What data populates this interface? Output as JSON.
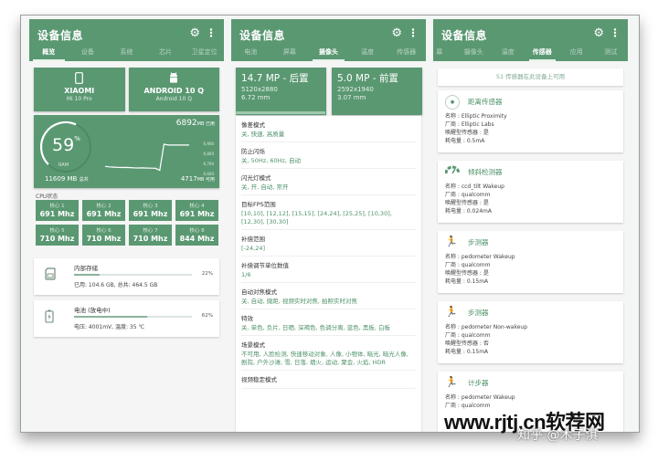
{
  "app_title": "设备信息",
  "icons": {
    "settings": "gear-icon",
    "more": "more-vert-icon"
  },
  "colors": {
    "primary": "#5a9872",
    "value_text": "#4d9168",
    "background": "#f5f5f5"
  },
  "panel1": {
    "tabs": [
      {
        "label": "概览",
        "active": true
      },
      {
        "label": "设备",
        "active": false
      },
      {
        "label": "系统",
        "active": false
      },
      {
        "label": "芯片",
        "active": false
      },
      {
        "label": "卫星定位",
        "active": false
      }
    ],
    "device": {
      "brand": "XIAOMI",
      "model": "Mi 10 Pro",
      "icon": "phone-icon"
    },
    "android": {
      "version": "ANDROID 10 Q",
      "sub": "Android 10 Q",
      "icon": "android-icon"
    },
    "ram": {
      "percent": "59",
      "percent_sign": "%",
      "label": "RAM",
      "used_value": "6892",
      "used_unit": "MB 已用",
      "total_value": "11609 MB",
      "total_unit": "总共",
      "free_value": "4717",
      "free_unit": "MB 可用",
      "usage_fraction": 0.59,
      "y_ticks": [
        "6,900",
        "6,800",
        "6,700",
        "6,600"
      ],
      "history": [
        6680,
        6675,
        6672,
        6670,
        6668,
        6669,
        6667,
        6665,
        6664,
        6665,
        6663,
        6662,
        6660,
        6640,
        6900,
        6892,
        6893,
        6892,
        6892,
        6892,
        6892
      ]
    },
    "cpu_label": "CPU状态",
    "cores": [
      {
        "name": "核心 1",
        "freq": "691 Mhz"
      },
      {
        "name": "核心 2",
        "freq": "691 Mhz"
      },
      {
        "name": "核心 3",
        "freq": "691 Mhz"
      },
      {
        "name": "核心 4",
        "freq": "691 Mhz"
      },
      {
        "name": "核心 5",
        "freq": "710 Mhz"
      },
      {
        "name": "核心 6",
        "freq": "710 Mhz"
      },
      {
        "name": "核心 7",
        "freq": "710 Mhz"
      },
      {
        "name": "核心 8",
        "freq": "844 Mhz"
      }
    ],
    "storage": {
      "title": "内部存储",
      "percent": 22,
      "percent_label": "22%",
      "detail": "已用: 104.6 GB, 总共: 464.5 GB",
      "icon": "sd-card-icon"
    },
    "battery": {
      "title": "电池 (放电中)",
      "percent": 62,
      "percent_label": "62%",
      "detail": "电压: 4001mV, 温度: 35 ℃",
      "icon": "battery-charging-icon"
    }
  },
  "panel2": {
    "tabs": [
      {
        "label": "电池",
        "active": false
      },
      {
        "label": "屏幕",
        "active": false
      },
      {
        "label": "摄像头",
        "active": true
      },
      {
        "label": "温度",
        "active": false
      },
      {
        "label": "传感器",
        "active": false
      }
    ],
    "cameras": [
      {
        "mp": "14.7 MP - 后置",
        "resolution": "5120x2880",
        "focal": "6.72 mm"
      },
      {
        "mp": "5.0 MP - 前置",
        "resolution": "2592x1940",
        "focal": "3.07 mm"
      }
    ],
    "properties": [
      {
        "key": "像差模式",
        "value": "关, 快速, 高质量"
      },
      {
        "key": "防止闪烁",
        "value": "关, 50Hz, 60Hz, 自动"
      },
      {
        "key": "闪光灯模式",
        "value": "关, 开, 自动, 常开"
      },
      {
        "key": "目标FPS范围",
        "value": "[10,10], [12,12], [15,15], [24,24], [25,25], [10,30], [12,30], [30,30]"
      },
      {
        "key": "补偿范围",
        "value": "[-24,24]"
      },
      {
        "key": "补偿调节单位数值",
        "value": "1/6"
      },
      {
        "key": "自动对焦模式",
        "value": "关, 自动, 微距, 视频实时对焦, 拍照实时对焦"
      },
      {
        "key": "特效",
        "value": "关, 单色, 负片, 日晒, 深褐色, 色调分离, 蓝色, 黑板, 白板"
      },
      {
        "key": "场景模式",
        "value": "不可用, 人脸检测, 快速移动对象, 人像, 小物体, 暗光, 暗光人像, 剧院, 户外沙滩, 雪, 日落, 烟火, 运动, 聚会, 火焰, HDR"
      },
      {
        "key": "视频稳定模式",
        "value": ""
      }
    ]
  },
  "panel3": {
    "tabs": [
      {
        "label": "幕",
        "active": false
      },
      {
        "label": "摄像头",
        "active": false
      },
      {
        "label": "温度",
        "active": false
      },
      {
        "label": "传感器",
        "active": true
      },
      {
        "label": "应用",
        "active": false
      },
      {
        "label": "测试",
        "active": false
      }
    ],
    "available": "51 传感器在此设备上可用",
    "sensors": [
      {
        "title": "距离传感器",
        "icon": "proximity-icon",
        "lines": [
          "名称 : Elliptic Proximity",
          "厂商 : Elliptic Labs",
          "唤醒型传感器 : 是",
          "耗电量 : 0.5mA"
        ]
      },
      {
        "title": "倾斜检测器",
        "icon": "gauge-icon",
        "lines": [
          "名称 : ccd_tilt  Wakeup",
          "厂商 : qualcomm",
          "唤醒型传感器 : 是",
          "耗电量 : 0.024mA"
        ]
      },
      {
        "title": "步测器",
        "icon": "running-icon",
        "lines": [
          "名称 : pedometer  Wakeup",
          "厂商 : qualcomm",
          "唤醒型传感器 : 是",
          "耗电量 : 0.15mA"
        ]
      },
      {
        "title": "步测器",
        "icon": "running-icon",
        "lines": [
          "名称 : pedometer  Non-wakeup",
          "厂商 : qualcomm",
          "唤醒型传感器 : 否",
          "耗电量 : 0.15mA"
        ]
      },
      {
        "title": "计步器",
        "icon": "running-icon",
        "lines": [
          "名称 : pedometer  Wakeup",
          "厂商 : qualcomm"
        ]
      }
    ]
  },
  "watermark": {
    "site": "www.rjtj.cn软荐网",
    "author": "知乎 @木子淇"
  }
}
